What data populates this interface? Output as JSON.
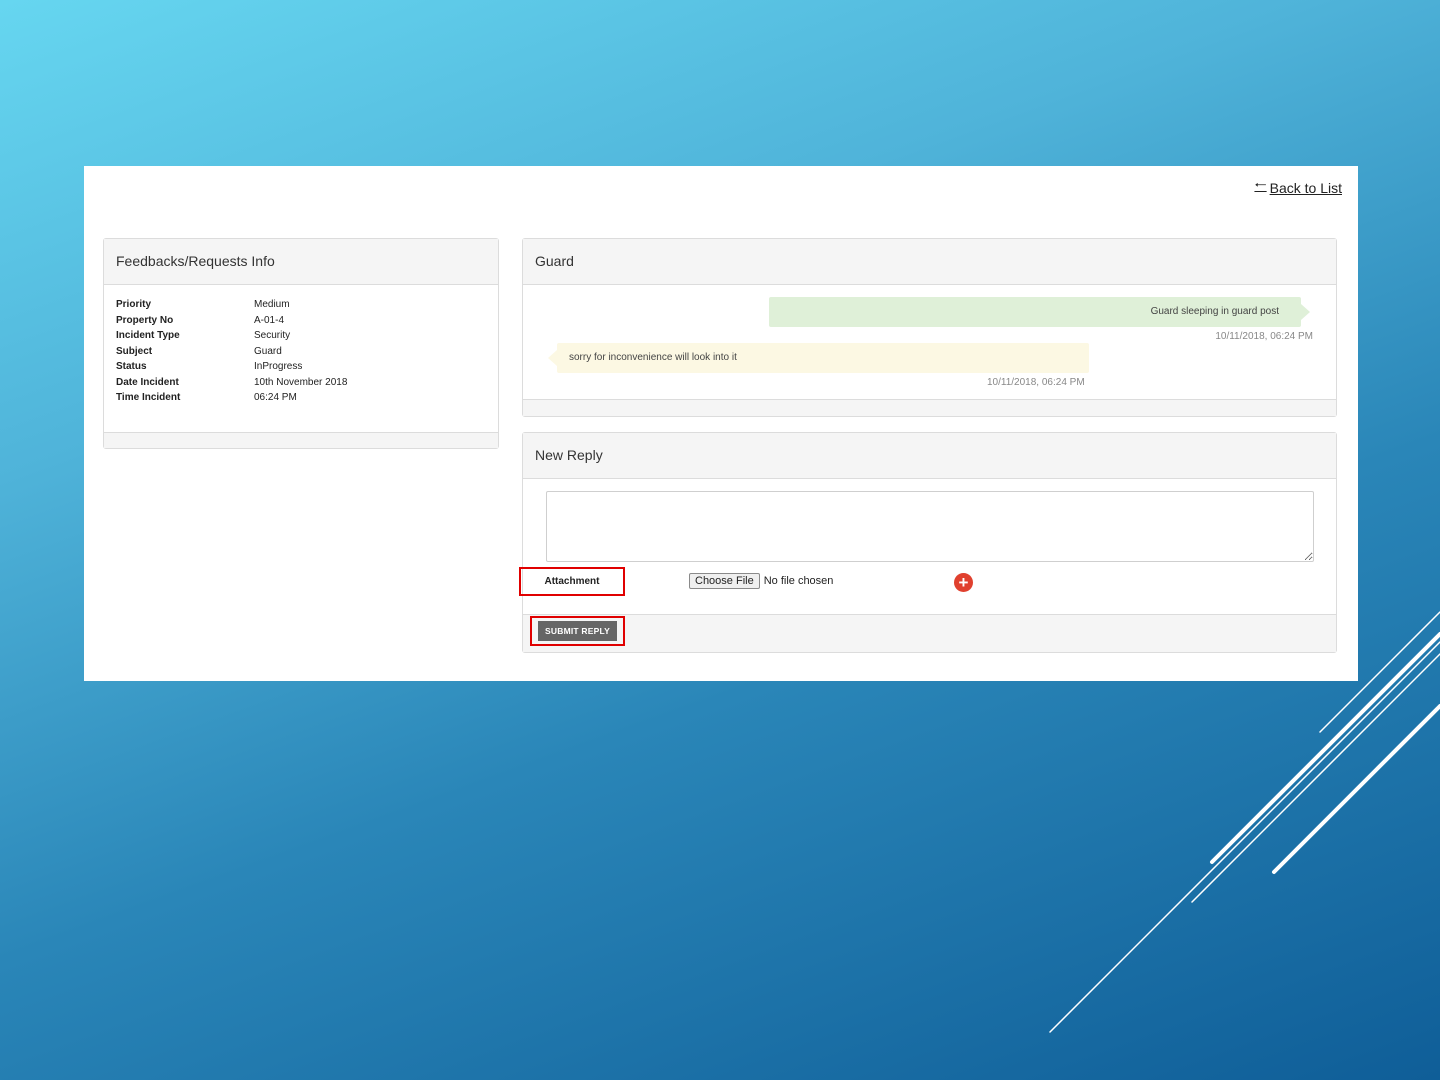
{
  "nav": {
    "back_label": "Back to List"
  },
  "info_panel": {
    "title": "Feedbacks/Requests Info",
    "rows": [
      {
        "key": "Priority",
        "value": "Medium"
      },
      {
        "key": "Property No",
        "value": "A-01-4"
      },
      {
        "key": "Incident Type",
        "value": "Security"
      },
      {
        "key": "Subject",
        "value": "Guard"
      },
      {
        "key": "Status",
        "value": "InProgress"
      },
      {
        "key": "Date Incident",
        "value": "10th November 2018"
      },
      {
        "key": "Time Incident",
        "value": "06:24 PM"
      }
    ]
  },
  "thread_panel": {
    "title": "Guard",
    "messages": [
      {
        "text": "Guard sleeping in guard post",
        "time": "10/11/2018, 06:24 PM",
        "side": "right"
      },
      {
        "text": "sorry for inconvenience will look into it",
        "time": "10/11/2018, 06:24 PM",
        "side": "left"
      }
    ]
  },
  "reply_panel": {
    "title": "New Reply",
    "textarea_value": "",
    "attachment_label": "Attachment",
    "file_button_label": "Choose File",
    "file_status": "No file chosen",
    "add_icon": "plus-circle-icon",
    "submit_label": "SUBMIT REPLY"
  },
  "colors": {
    "highlight_frame": "#e00000",
    "sent_bubble": "#dff0d8",
    "received_bubble": "#fcf8e3",
    "add_button": "#e0402e"
  }
}
